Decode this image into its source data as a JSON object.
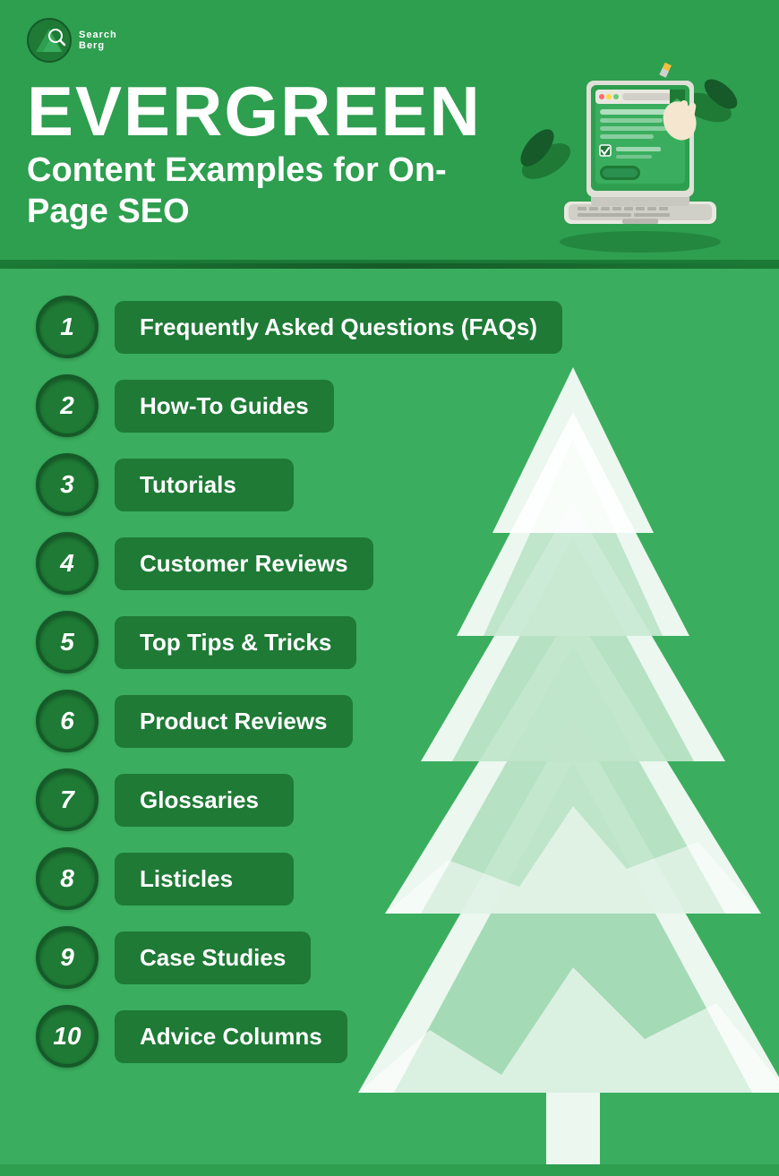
{
  "logo": {
    "alt": "Search Berg",
    "text": "Search Berg"
  },
  "header": {
    "title_main": "EVERGREEN",
    "title_sub": "Content Examples for On-Page SEO"
  },
  "list": {
    "items": [
      {
        "number": "1",
        "label": "Frequently Asked Questions (FAQs)"
      },
      {
        "number": "2",
        "label": "How-To Guides"
      },
      {
        "number": "3",
        "label": "Tutorials"
      },
      {
        "number": "4",
        "label": "Customer Reviews"
      },
      {
        "number": "5",
        "label": "Top Tips & Tricks"
      },
      {
        "number": "6",
        "label": "Product Reviews"
      },
      {
        "number": "7",
        "label": "Glossaries"
      },
      {
        "number": "8",
        "label": "Listicles"
      },
      {
        "number": "9",
        "label": "Case Studies"
      },
      {
        "number": "10",
        "label": "Advice Columns"
      }
    ]
  },
  "colors": {
    "bg_main": "#2e9e4f",
    "bg_list": "#3aae5e",
    "dark_green": "#1e7a35",
    "white": "#ffffff"
  }
}
